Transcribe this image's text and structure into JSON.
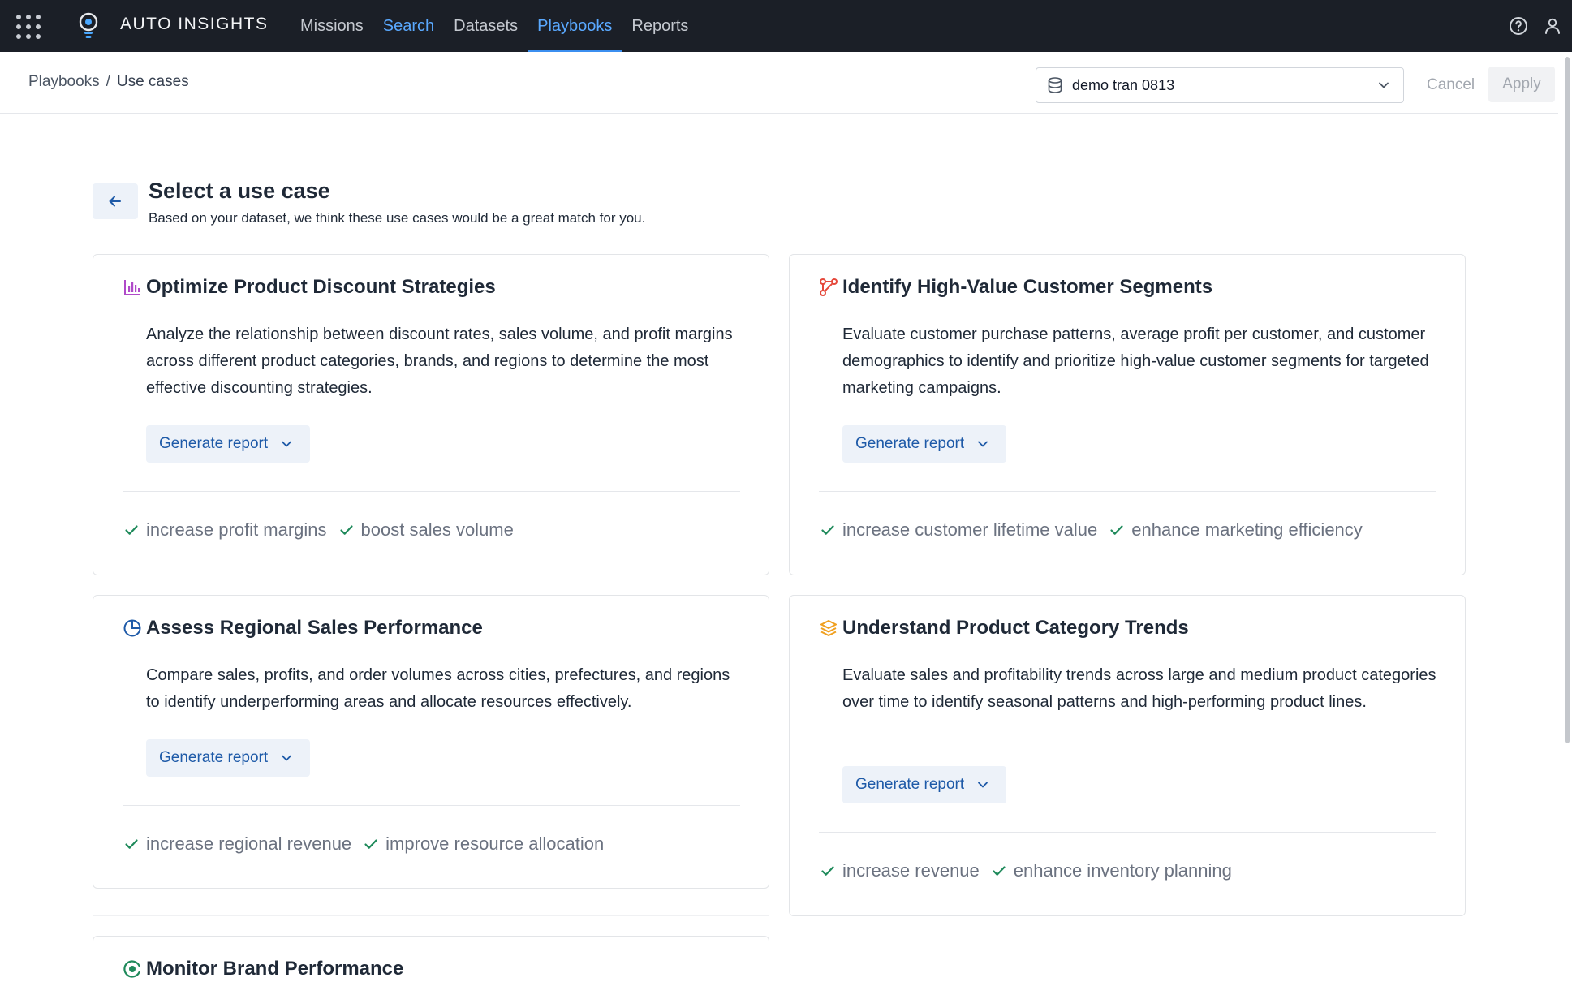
{
  "app": {
    "brand": "AUTO INSIGHTS",
    "nav": [
      "Missions",
      "Search",
      "Datasets",
      "Playbooks",
      "Reports"
    ],
    "active_nav": "Playbooks"
  },
  "breadcrumb": {
    "parent": "Playbooks",
    "separator": "/",
    "current": "Use cases"
  },
  "dataset_select": {
    "value": "demo tran 0813"
  },
  "actions": {
    "cancel": "Cancel",
    "apply": "Apply"
  },
  "page": {
    "title": "Select a use case",
    "subtitle": "Based on your dataset, we think these use cases would be a great match for you."
  },
  "cards": [
    {
      "icon": "bar-chart-icon",
      "icon_color": "#b04ac9",
      "title": "Optimize Product Discount Strategies",
      "description": "Analyze the relationship between discount rates, sales volume, and profit margins across different product categories, brands, and regions to determine the most effective discounting strategies.",
      "button": "Generate report",
      "tags": [
        "increase profit margins",
        "boost sales volume"
      ]
    },
    {
      "icon": "segments-icon",
      "icon_color": "#e5483b",
      "title": "Identify High-Value Customer Segments",
      "description": "Evaluate customer purchase patterns, average profit per customer, and customer demographics to identify and prioritize high-value customer segments for targeted marketing campaigns.",
      "button": "Generate report",
      "tags": [
        "increase customer lifetime value",
        "enhance marketing efficiency"
      ]
    },
    {
      "icon": "pie-chart-icon",
      "icon_color": "#1e5aa8",
      "title": "Assess Regional Sales Performance",
      "description": "Compare sales, profits, and order volumes across cities, prefectures, and regions to identify underperforming areas and allocate resources effectively.",
      "button": "Generate report",
      "tags": [
        "increase regional revenue",
        "improve resource allocation"
      ]
    },
    {
      "icon": "layers-icon",
      "icon_color": "#f0a020",
      "title": "Understand Product Category Trends",
      "description": "Evaluate sales and profitability trends across large and medium product categories over time to identify seasonal patterns and high-performing product lines.",
      "button": "Generate report",
      "tags": [
        "increase revenue",
        "enhance inventory planning"
      ]
    },
    {
      "icon": "target-icon",
      "icon_color": "#1f8a5b",
      "title": "Monitor Brand Performance"
    }
  ],
  "colors": {
    "topbar": "#1b1f27",
    "accent": "#3b8ff0",
    "check": "#1f8a5b",
    "button_bg": "#edf2f9",
    "button_text": "#1e5aa8"
  }
}
